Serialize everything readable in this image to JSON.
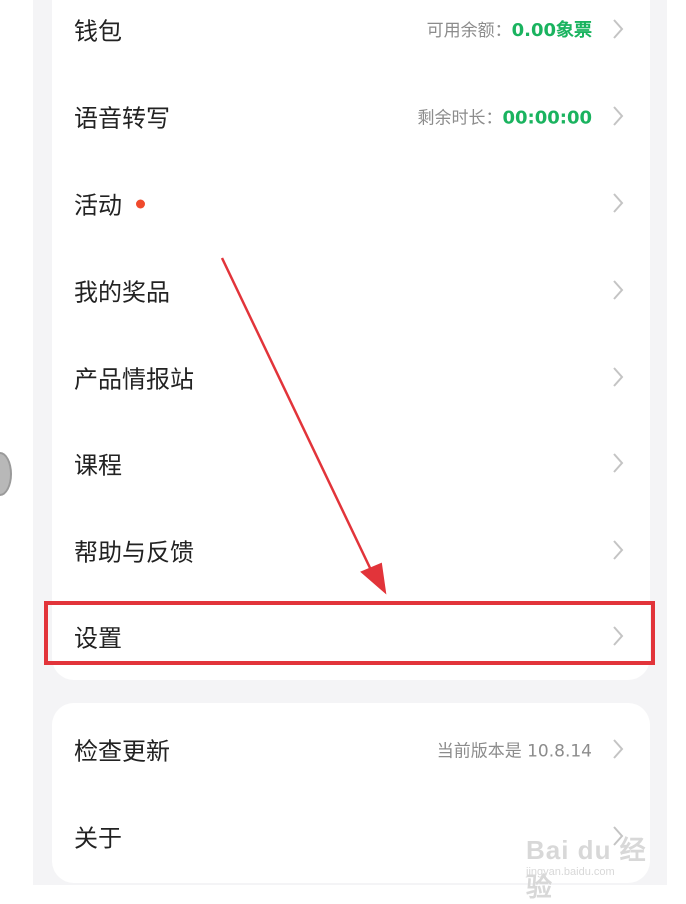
{
  "menu_items": [
    {
      "label": "钱包",
      "sub_prefix": "可用余额：",
      "sub_value": "0.00象票"
    },
    {
      "label": "语音转写",
      "sub_prefix": "剩余时长：",
      "sub_value": "00:00:00"
    },
    {
      "label": "活动"
    },
    {
      "label": "我的奖品"
    },
    {
      "label": "产品情报站"
    },
    {
      "label": "课程"
    },
    {
      "label": "帮助与反馈"
    },
    {
      "label": "设置"
    }
  ],
  "bottom_items": [
    {
      "label": "检查更新",
      "sub": "当前版本是 10.8.14"
    },
    {
      "label": "关于"
    }
  ],
  "watermark": {
    "main": "Bai du 经验",
    "url": "jingyan.baidu.com"
  },
  "colors": {
    "accent_green": "#1ab35f",
    "badge_red": "#f04a2c",
    "highlight_red": "#e2343a"
  }
}
